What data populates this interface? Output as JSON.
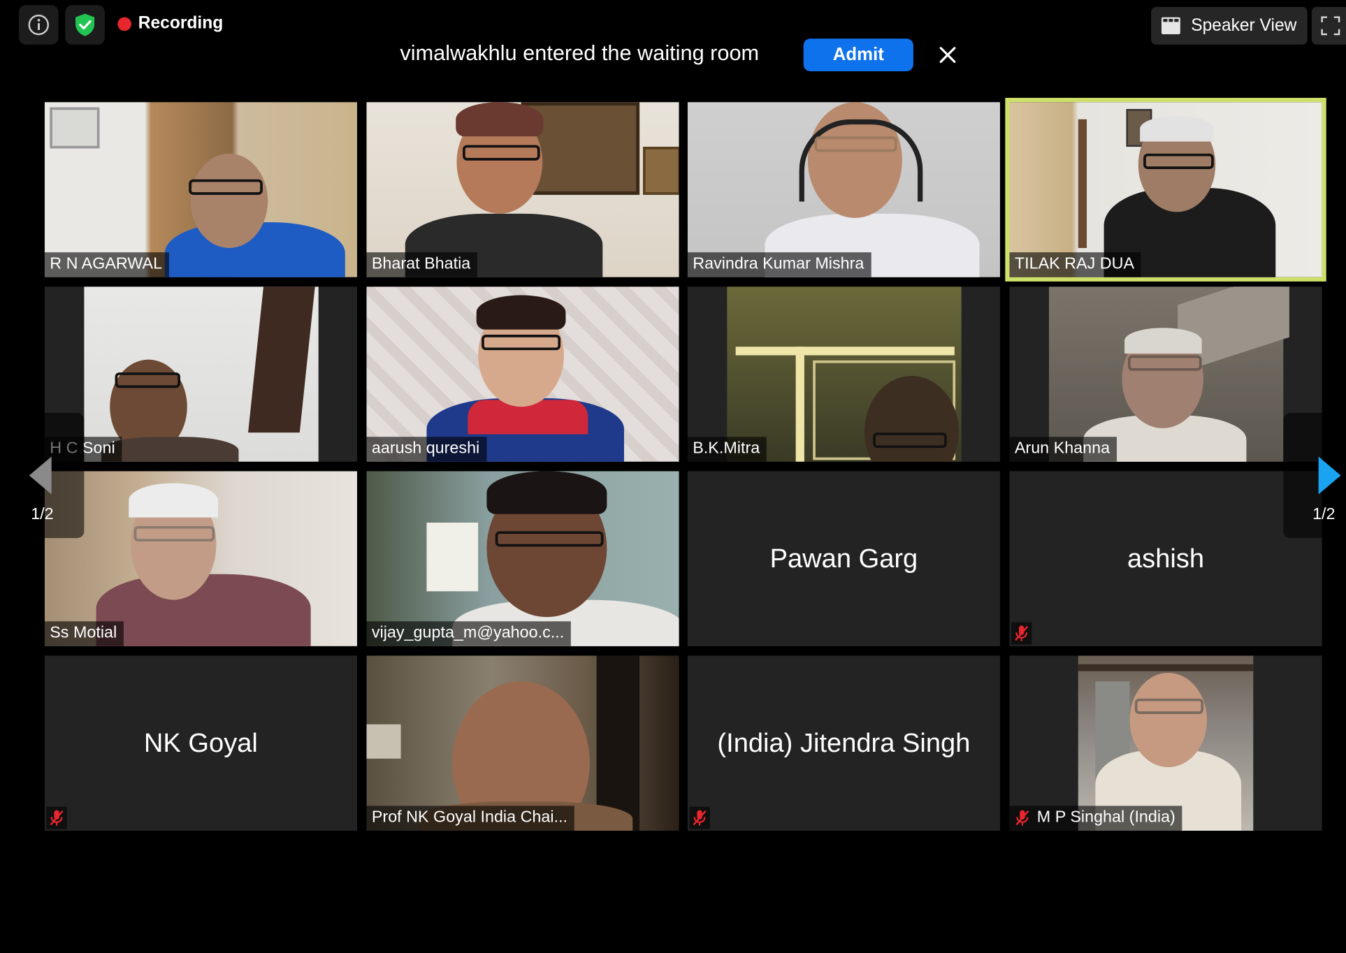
{
  "top_bar": {
    "info_icon": "info-icon",
    "security_icon": "shield-check-icon",
    "recording_label": "Recording",
    "view_label": "Speaker View",
    "view_icon": "grid-icon",
    "fullscreen_icon": "fullscreen-icon"
  },
  "notification": {
    "message": "vimalwakhlu entered the waiting room",
    "admit_label": "Admit",
    "close_icon": "close-icon"
  },
  "paging": {
    "left_label": "1/2",
    "right_label": "1/2",
    "prev_icon": "arrow-left-icon",
    "next_icon": "arrow-right-icon"
  },
  "participants": [
    {
      "name": "R N AGARWAL",
      "video": true,
      "muted": false
    },
    {
      "name": "Bharat Bhatia",
      "video": true,
      "muted": false
    },
    {
      "name": "Ravindra Kumar Mishra",
      "video": true,
      "muted": false
    },
    {
      "name": "TILAK RAJ DUA",
      "video": true,
      "muted": false,
      "active_speaker": true
    },
    {
      "name": "H C Soni",
      "video": true,
      "muted": false
    },
    {
      "name": "aarush qureshi",
      "video": true,
      "muted": false
    },
    {
      "name": "B.K.Mitra",
      "video": true,
      "muted": false
    },
    {
      "name": "Arun Khanna",
      "video": true,
      "muted": false
    },
    {
      "name": "Ss Motial",
      "video": true,
      "muted": false
    },
    {
      "name": "vijay_gupta_m@yahoo.c...",
      "video": true,
      "muted": false
    },
    {
      "name": "Pawan Garg",
      "video": false,
      "muted": false
    },
    {
      "name": "ashish",
      "video": false,
      "muted": true
    },
    {
      "name": "NK Goyal",
      "video": false,
      "muted": true
    },
    {
      "name": "Prof NK Goyal India Chai...",
      "video": true,
      "muted": false
    },
    {
      "name": "(India) Jitendra Singh",
      "video": false,
      "muted": true
    },
    {
      "name": "M P Singhal (India)",
      "video": true,
      "muted": true
    }
  ],
  "colors": {
    "active_speaker_border": "#cfe06a",
    "admit_button": "#0e72ed",
    "recording_dot": "#e8262d",
    "mute_icon": "#e8262d",
    "security_icon": "#23c552",
    "page_arrow_next": "#1aa3f0"
  }
}
